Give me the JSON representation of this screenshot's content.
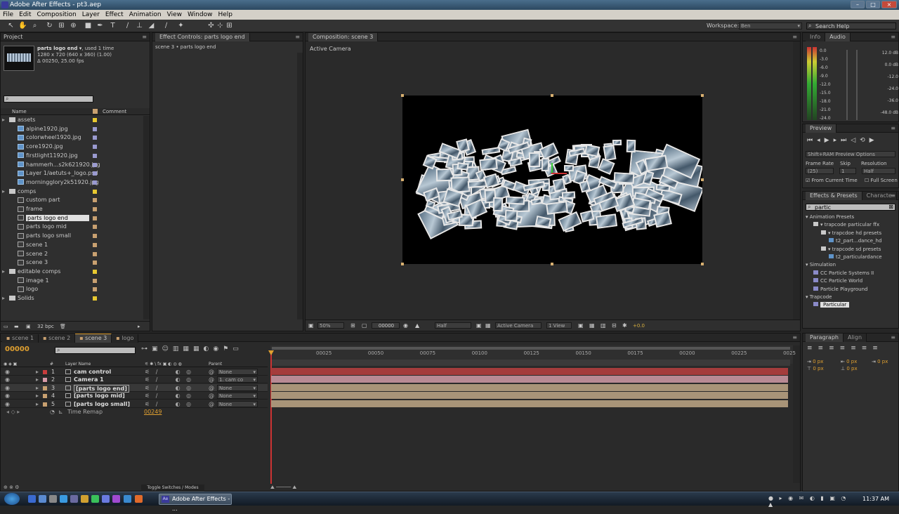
{
  "title": "Adobe After Effects - pt3.aep",
  "menu": [
    "File",
    "Edit",
    "Composition",
    "Layer",
    "Effect",
    "Animation",
    "View",
    "Window",
    "Help"
  ],
  "workspace": {
    "label": "Workspace:",
    "value": "Ben"
  },
  "search_help": "Search Help",
  "project": {
    "tab": "Project",
    "selected_name": "parts logo end ▾",
    "used": ", used 1 time",
    "dims": "1280 x 720  (640 x 360) (1.00)",
    "duration": "Δ 00250, 25.00 fps",
    "col_name": "Name",
    "col_comment": "Comment",
    "bpc": "32 bpc",
    "items": [
      {
        "name": "assets",
        "type": "folder",
        "depth": 0,
        "label": "#e8c830"
      },
      {
        "name": "alpine1920.jpg",
        "type": "file",
        "depth": 1,
        "label": "#9a9ad0"
      },
      {
        "name": "colorwheel1920.jpg",
        "type": "file",
        "depth": 1,
        "label": "#9a9ad0"
      },
      {
        "name": "core1920.jpg",
        "type": "file",
        "depth": 1,
        "label": "#9a9ad0"
      },
      {
        "name": "firstlight11920.jpg",
        "type": "file",
        "depth": 1,
        "label": "#9a9ad0"
      },
      {
        "name": "hammerh...s2k621920.jpg",
        "type": "file",
        "depth": 1,
        "label": "#9a9ad0"
      },
      {
        "name": "Layer 1/aetuts+_logo.psd",
        "type": "file",
        "depth": 1,
        "label": "#9a9ad0"
      },
      {
        "name": "morningglory2k51920.jpg",
        "type": "file",
        "depth": 1,
        "label": "#9a9ad0"
      },
      {
        "name": "comps",
        "type": "folder",
        "depth": 0,
        "label": "#e8c830"
      },
      {
        "name": "custom part",
        "type": "comp",
        "depth": 1,
        "label": "#c8a070"
      },
      {
        "name": "frame",
        "type": "comp",
        "depth": 1,
        "label": "#c8a070"
      },
      {
        "name": "parts logo end",
        "type": "comp",
        "depth": 1,
        "label": "#c8a070",
        "selected": true
      },
      {
        "name": "parts logo mid",
        "type": "comp",
        "depth": 1,
        "label": "#c8a070"
      },
      {
        "name": "parts logo small",
        "type": "comp",
        "depth": 1,
        "label": "#c8a070"
      },
      {
        "name": "scene 1",
        "type": "comp",
        "depth": 1,
        "label": "#c8a070"
      },
      {
        "name": "scene 2",
        "type": "comp",
        "depth": 1,
        "label": "#c8a070"
      },
      {
        "name": "scene 3",
        "type": "comp",
        "depth": 1,
        "label": "#c8a070"
      },
      {
        "name": "editable comps",
        "type": "folder",
        "depth": 0,
        "label": "#e8c830"
      },
      {
        "name": "image 1",
        "type": "comp",
        "depth": 1,
        "label": "#c8a070"
      },
      {
        "name": "logo",
        "type": "comp",
        "depth": 1,
        "label": "#c8a070"
      },
      {
        "name": "Solids",
        "type": "folder",
        "depth": 0,
        "label": "#e8c830"
      }
    ]
  },
  "effect_controls": {
    "tab": "Effect Controls: parts logo end",
    "sub": "scene 3 • parts logo end"
  },
  "composition": {
    "tab": "Composition: scene 3",
    "camera_label": "Active Camera",
    "zoom": "50%",
    "timecode": "00000",
    "resolution": "Half",
    "camera": "Active Camera",
    "view": "1 View",
    "exposure": "+0.0"
  },
  "info": {
    "tab1": "Info",
    "tab2": "Audio",
    "left_scale": [
      "0.0",
      "-3.0",
      "-6.0",
      "-9.0",
      "-12.0",
      "-15.0",
      "-18.0",
      "-21.0",
      "-24.0"
    ],
    "right_scale": [
      "12.0 dB",
      "0.0 dB",
      "-12.0",
      "-24.0",
      "-36.0",
      "-48.0 dB"
    ]
  },
  "preview": {
    "tab": "Preview",
    "options": "Shift+RAM Preview Options",
    "frame_rate_label": "Frame Rate",
    "skip_label": "Skip",
    "resolution_label": "Resolution",
    "frame_rate": "(25)",
    "skip": "1",
    "resolution": "Half",
    "from_current": "From Current Time",
    "full_screen": "Full Screen"
  },
  "effects": {
    "tab": "Effects & Presets",
    "tab2": "Characte",
    "search": "partic",
    "tree": [
      {
        "text": "▾ Animation Presets",
        "indent": 0
      },
      {
        "text": "▾ trapcode particular ffx",
        "indent": 1,
        "folder": true
      },
      {
        "text": "▾ trapcdoe hd presets",
        "indent": 2,
        "folder": true
      },
      {
        "text": "t2_part...dance_hd",
        "indent": 3,
        "preset": true
      },
      {
        "text": "▾ trapcode sd presets",
        "indent": 2,
        "folder": true
      },
      {
        "text": "t2_particulardance",
        "indent": 3,
        "preset": true
      },
      {
        "text": "▾ Simulation",
        "indent": 0
      },
      {
        "text": "CC Particle Systems II",
        "indent": 1,
        "fx": true
      },
      {
        "text": "CC Particle World",
        "indent": 1,
        "fx": true
      },
      {
        "text": "Particle Playground",
        "indent": 1,
        "fx": true
      },
      {
        "text": "▾ Trapcode",
        "indent": 0
      },
      {
        "text": "Particular",
        "indent": 1,
        "fx": true,
        "selected": true
      }
    ]
  },
  "paragraph": {
    "tab": "Paragraph",
    "tab2": "Align",
    "px": [
      "0 px",
      "0 px",
      "0 px",
      "0 px",
      "0 px"
    ]
  },
  "timeline": {
    "tabs": [
      "scene 1",
      "scene 2",
      "scene 3",
      "logo"
    ],
    "active_tab": 2,
    "timecode": "00000",
    "col_layer": "Layer Name",
    "col_parent": "Parent",
    "toggle": "Toggle Switches / Modes",
    "ruler": [
      "00025",
      "00050",
      "00075",
      "00100",
      "00125",
      "00150",
      "00175",
      "00200",
      "00225",
      "0025"
    ],
    "layers": [
      {
        "num": "1",
        "name": "cam control",
        "parent": "None",
        "color": "#c83c3c",
        "bar": "#a43c3c"
      },
      {
        "num": "2",
        "name": "Camera 1",
        "parent": "1. cam co",
        "color": "#d89aa8",
        "bar": "#b88a94"
      },
      {
        "num": "3",
        "name": "[parts logo end]",
        "parent": "None",
        "color": "#c8a070",
        "bar": "#a89478",
        "selected": true
      },
      {
        "num": "4",
        "name": "[parts logo mid]",
        "parent": "None",
        "color": "#c8a070",
        "bar": "#a89478"
      },
      {
        "num": "5",
        "name": "[parts logo small]",
        "parent": "None",
        "color": "#c8a070",
        "bar": "#a89478"
      }
    ],
    "remap_label": "Time Remap",
    "remap_value": "00249"
  },
  "taskbar": {
    "task": "Adobe After Effects - ...",
    "time": "11:37 AM"
  }
}
